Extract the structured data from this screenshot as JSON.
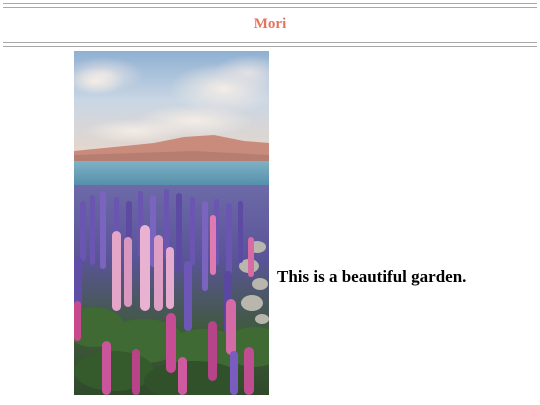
{
  "header": {
    "brand": "Mori"
  },
  "main": {
    "image_alt": "lupine garden by a lake",
    "caption": "This is a beautiful garden."
  },
  "colors": {
    "brand": "#e8735c",
    "rule": "#a8a8a8",
    "caption": "#000000"
  }
}
